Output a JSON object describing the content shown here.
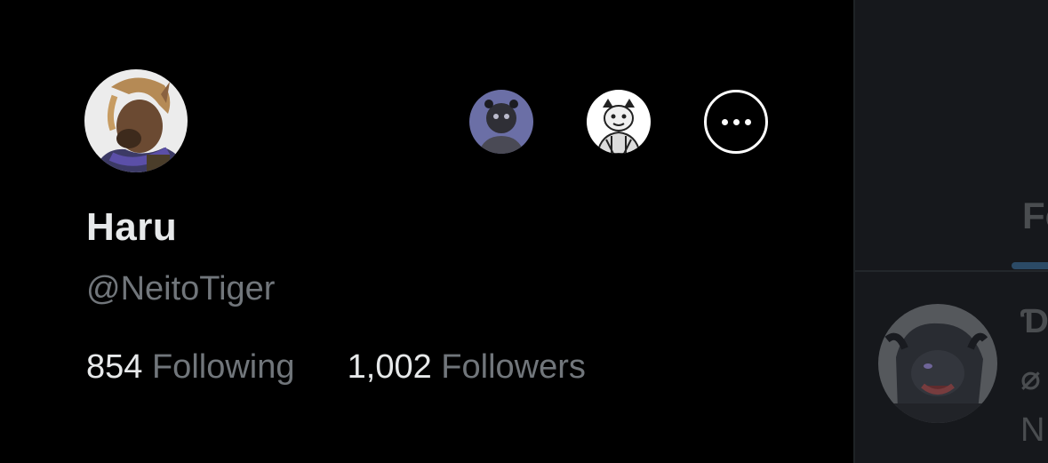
{
  "profile": {
    "display_name": "Haru",
    "handle": "@NeitoTiger",
    "following_count": "854",
    "following_label": "Following",
    "followers_count": "1,002",
    "followers_label": "Followers"
  },
  "accounts": {
    "more_icon": "more-horizontal-icon"
  },
  "background": {
    "tab_partial": "Fo",
    "glyph_1": "Ɗ",
    "glyph_2": "⌀",
    "glyph_3": "N"
  },
  "colors": {
    "background": "#000000",
    "text_primary": "#e7e9ea",
    "text_secondary": "#71767b",
    "dim_pane": "#16181c"
  }
}
